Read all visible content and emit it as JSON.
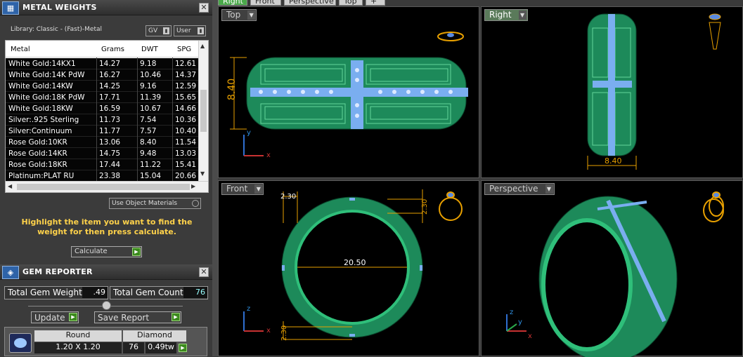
{
  "metal_panel": {
    "title": "METAL WEIGHTS",
    "library": "Library: Classic - (Fast)-Metal",
    "sel1": "GV",
    "sel2": "User",
    "columns": [
      "Metal",
      "Grams",
      "DWT",
      "SPG"
    ],
    "rows": [
      [
        "White Gold:14KX1",
        "14.27",
        "9.18",
        "12.61"
      ],
      [
        "White Gold:14K PdW",
        "16.27",
        "10.46",
        "14.37"
      ],
      [
        "White Gold:14KW",
        "14.25",
        "9.16",
        "12.59"
      ],
      [
        "White Gold:18K PdW",
        "17.71",
        "11.39",
        "15.65"
      ],
      [
        "White Gold:18KW",
        "16.59",
        "10.67",
        "14.66"
      ],
      [
        "Silver:.925 Sterling",
        "11.73",
        "7.54",
        "10.36"
      ],
      [
        "Silver:Continuum",
        "11.77",
        "7.57",
        "10.40"
      ],
      [
        "Rose Gold:10KR",
        "13.06",
        "8.40",
        "11.54"
      ],
      [
        "Rose Gold:14KR",
        "14.75",
        "9.48",
        "13.03"
      ],
      [
        "Rose Gold:18KR",
        "17.44",
        "11.22",
        "15.41"
      ],
      [
        "Platinum:PLAT RU",
        "23.38",
        "15.04",
        "20.66"
      ]
    ],
    "use_object_materials": "Use Object Materials",
    "hint": "Highlight the item you want to find the weight for then press calculate.",
    "calculate": "Calculate"
  },
  "gem_panel": {
    "title": "GEM REPORTER",
    "total_weight_label": "Total Gem Weight",
    "total_weight": ".49",
    "total_count_label": "Total Gem Count",
    "total_count": "76",
    "update": "Update",
    "save_report": "Save Report",
    "shape": "Round",
    "type": "Diamond",
    "size": "1.20 X 1.20",
    "count": "76",
    "weight": "0.49tw"
  },
  "tabs": [
    "Right",
    "Front",
    "Perspective",
    "Top"
  ],
  "viewports": {
    "top": {
      "label": "Top",
      "dim": "8.40"
    },
    "right": {
      "label": "Right",
      "dim": "8.40"
    },
    "front": {
      "label": "Front",
      "dim_diam": "20.50",
      "dim_top": "2.30",
      "dim_side": "2.30",
      "dim_bottom": "2.30"
    },
    "perspective": {
      "label": "Perspective"
    }
  },
  "axes": {
    "x": "x",
    "y": "y",
    "z": "z"
  },
  "colors": {
    "ring": "#1d8a5a",
    "ring_dark": "#0f5a3a",
    "gem": "#7aaef0",
    "dim": "#e8a000"
  }
}
